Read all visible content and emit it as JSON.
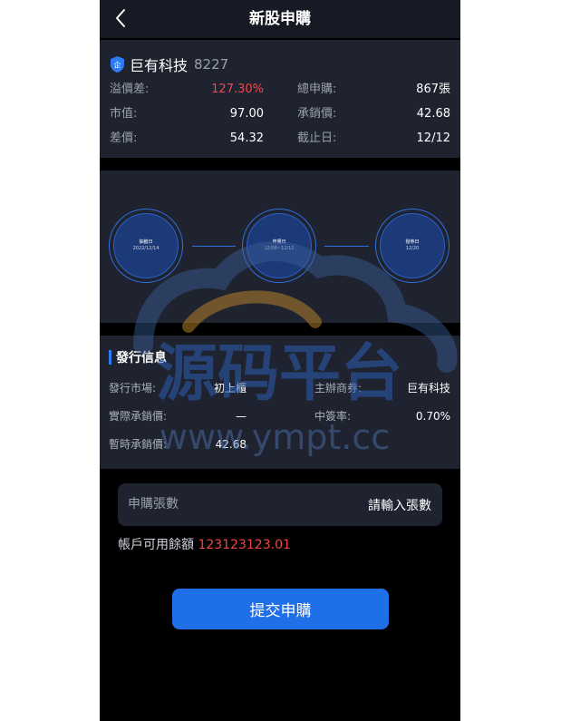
{
  "header": {
    "title": "新股申購"
  },
  "stock": {
    "name": "巨有科技",
    "code": "8227",
    "left": [
      {
        "label": "溢價差:",
        "value": "127.30%",
        "highlight": true
      },
      {
        "label": "市值:",
        "value": "97.00",
        "highlight": false
      },
      {
        "label": "差價:",
        "value": "54.32",
        "highlight": false
      }
    ],
    "right": [
      {
        "label": "總申購:",
        "value": "867張"
      },
      {
        "label": "承銷價:",
        "value": "42.68"
      },
      {
        "label": "截止日:",
        "value": "12/12"
      }
    ]
  },
  "timeline": {
    "nodes": [
      {
        "label": "抽籤日",
        "date": "2022/12/14"
      },
      {
        "label": "申購日",
        "date": "12/08~12/12"
      },
      {
        "label": "撥券日",
        "date": "12/20"
      }
    ]
  },
  "issue": {
    "title": "發行信息",
    "left": [
      {
        "label": "發行市場:",
        "value": "初上櫃"
      },
      {
        "label": "實際承銷價:",
        "value": "—"
      },
      {
        "label": "暫時承銷價:",
        "value": "42.68"
      }
    ],
    "right": [
      {
        "label": "主辦商券:",
        "value": "巨有科技"
      },
      {
        "label": "中簽率:",
        "value": "0.70%"
      }
    ]
  },
  "subscribe": {
    "label": "申購張數",
    "placeholder": "請輸入張數",
    "balance_label": "帳戶可用餘額",
    "balance_value": "123123123.01",
    "submit_label": "提交申購"
  },
  "watermark": {
    "text_cn": "源码平台",
    "text_url": "www.ympt.cc"
  },
  "colors": {
    "accent": "#1f6fe8",
    "negative": "#f0464b",
    "card": "#1f2330",
    "header": "#171a24"
  }
}
